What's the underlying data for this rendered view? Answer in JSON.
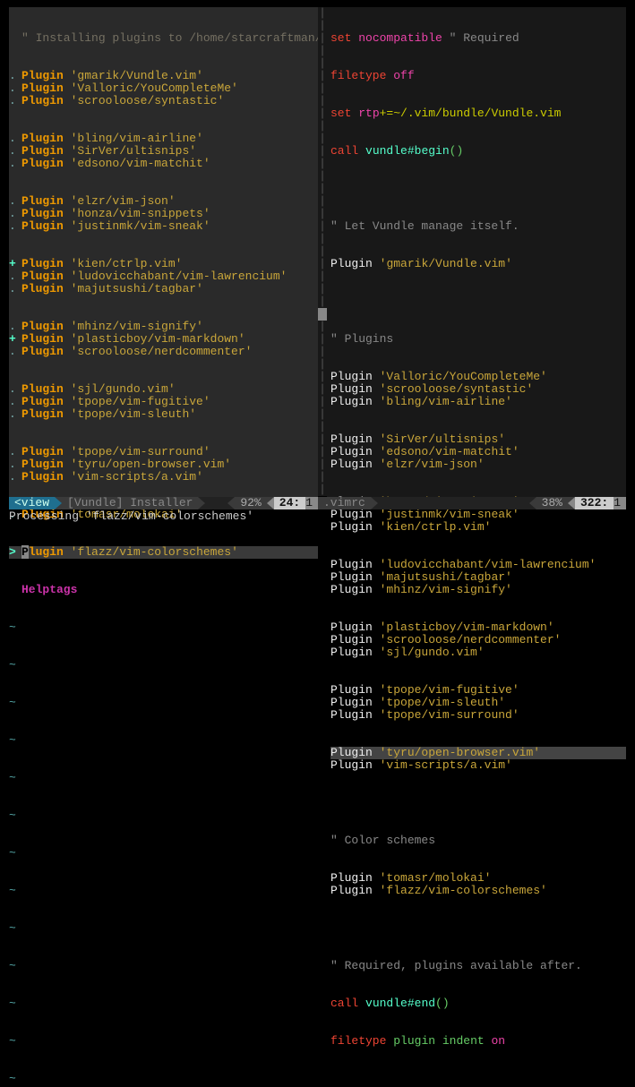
{
  "left": {
    "header_comment": "\" Installing plugins to /home/starcraftman/.vim/bundle",
    "plugins": [
      "gmarik/Vundle.vim",
      "Valloric/YouCompleteMe",
      "scrooloose/syntastic",
      "bling/vim-airline",
      "SirVer/ultisnips",
      "edsono/vim-matchit",
      "elzr/vim-json",
      "honza/vim-snippets",
      "justinmk/vim-sneak",
      "kien/ctrlp.vim",
      "ludovicchabant/vim-lawrencium",
      "majutsushi/tagbar",
      "mhinz/vim-signify",
      "plasticboy/vim-markdown",
      "scrooloose/nerdcommenter",
      "sjl/gundo.vim",
      "tpope/vim-fugitive",
      "tpope/vim-sleuth",
      "tpope/vim-surround",
      "tyru/open-browser.vim",
      "vim-scripts/a.vim",
      "tomasr/molokai",
      "flazz/vim-colorschemes"
    ],
    "gutters": [
      ".",
      ".",
      ". ",
      ". ",
      ".",
      ".",
      ".",
      ".",
      ".",
      "+",
      ".",
      ".",
      ".",
      "+",
      ".",
      ".",
      ".",
      ".",
      ".",
      ".",
      ".",
      ".",
      "> "
    ],
    "plugin_kw": "Plugin",
    "helptags": "Helptags",
    "tilde": "~",
    "status": {
      "mode": "<view",
      "title": "[Vundle] Installer",
      "pct": "92%",
      "line": "24:",
      "col": "1"
    }
  },
  "right": {
    "l01a": "set",
    "l01b": "nocompatible",
    "l01c": "\" Required",
    "l02a": "filetype",
    "l02b": "off",
    "l03a": "set",
    "l03b": "rtp",
    "l03c": "+=~/.vim/bundle/Vundle.vim",
    "l04a": "call",
    "l04b": "vundle#begin",
    "l04c": "()",
    "c1": "\" Let Vundle manage itself.",
    "p_self": "gmarik/Vundle.vim",
    "c2": "\" Plugins",
    "plugins": [
      "Valloric/YouCompleteMe",
      "scrooloose/syntastic",
      "bling/vim-airline",
      "SirVer/ultisnips",
      "edsono/vim-matchit",
      "elzr/vim-json",
      "honza/vim-snippets",
      "justinmk/vim-sneak",
      "kien/ctrlp.vim",
      "ludovicchabant/vim-lawrencium",
      "majutsushi/tagbar",
      "mhinz/vim-signify",
      "plasticboy/vim-markdown",
      "scrooloose/nerdcommenter",
      "sjl/gundo.vim",
      "tpope/vim-fugitive",
      "tpope/vim-sleuth",
      "tpope/vim-surround",
      "tyru/open-browser.vim",
      "vim-scripts/a.vim"
    ],
    "plugin_kw": "Plugin",
    "c3": "\" Color schemes",
    "color_plugins": [
      "tomasr/molokai",
      "flazz/vim-colorschemes"
    ],
    "c4": "\" Required, plugins available after.",
    "l_end_a": "call",
    "l_end_b": "vundle#end",
    "l_end_c": "()",
    "l_ft_a": "filetype",
    "l_ft_b": "plugin",
    "l_ft_c": "indent",
    "l_ft_d": "on",
    "status": {
      "file": ".vimrc",
      "pct": "38%",
      "line": "322:",
      "col": "1"
    }
  },
  "cmdline": "Processing 'flazz/vim-colorschemes'"
}
